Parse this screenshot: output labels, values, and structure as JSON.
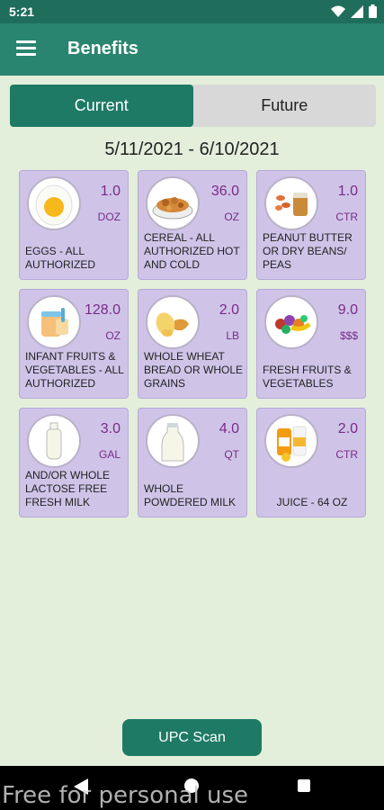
{
  "status_bar": {
    "time": "5:21"
  },
  "app_bar": {
    "title": "Benefits"
  },
  "tabs": [
    {
      "label": "Current",
      "active": true
    },
    {
      "label": "Future",
      "active": false
    }
  ],
  "date_range": "5/11/2021 - 6/10/2021",
  "benefits": [
    {
      "qty": "1.0",
      "unit": "DOZ",
      "label": "EGGS - ALL AUTHORIZED",
      "icon": "egg-icon"
    },
    {
      "qty": "36.0",
      "unit": "OZ",
      "label": "CEREAL - ALL AUTHORIZED HOT AND COLD",
      "icon": "cereal-icon"
    },
    {
      "qty": "1.0",
      "unit": "CTR",
      "label": "PEANUT BUTTER OR DRY BEANS/ PEAS",
      "icon": "peanut-butter-icon"
    },
    {
      "qty": "128.0",
      "unit": "OZ",
      "label": "INFANT FRUITS & VEGETABLES - ALL AUTHORIZED",
      "icon": "baby-food-icon"
    },
    {
      "qty": "2.0",
      "unit": "LB",
      "label": "WHOLE WHEAT BREAD OR WHOLE GRAINS",
      "icon": "bread-icon"
    },
    {
      "qty": "9.0",
      "unit": "$$$",
      "label": "FRESH FRUITS & VEGETABLES",
      "icon": "fruits-vegetables-icon"
    },
    {
      "qty": "3.0",
      "unit": "GAL",
      "label": "AND/OR WHOLE LACTOSE FREE FRESH MILK",
      "icon": "milk-jug-icon"
    },
    {
      "qty": "4.0",
      "unit": "QT",
      "label": "WHOLE POWDERED MILK",
      "icon": "milk-bottle-icon"
    },
    {
      "qty": "2.0",
      "unit": "CTR",
      "label": "JUICE - 64 OZ",
      "icon": "juice-icon"
    }
  ],
  "upc_button": "UPC Scan",
  "watermark": "Free for personal use",
  "colors": {
    "primary": "#2a8570",
    "status_bar": "#1f6e5c",
    "card": "#cfc4e8",
    "qty_text": "#7a2a86",
    "background": "#e3efdb"
  }
}
